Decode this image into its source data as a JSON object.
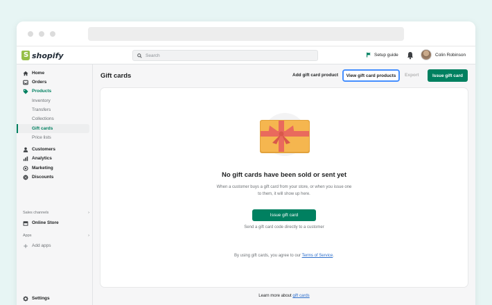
{
  "topbar": {
    "brand": "shopify",
    "search_placeholder": "Search",
    "setup_guide": "Setup guide",
    "user_name": "Colin Robinson"
  },
  "sidebar": {
    "items": [
      {
        "label": "Home",
        "icon": "home-icon"
      },
      {
        "label": "Orders",
        "icon": "orders-icon"
      },
      {
        "label": "Products",
        "icon": "tag-icon"
      }
    ],
    "product_subitems": [
      "Inventory",
      "Transfers",
      "Collections",
      "Gift cards",
      "Price lists"
    ],
    "items2": [
      {
        "label": "Customers",
        "icon": "person-icon"
      },
      {
        "label": "Analytics",
        "icon": "bar-chart-icon"
      },
      {
        "label": "Marketing",
        "icon": "target-icon"
      },
      {
        "label": "Discounts",
        "icon": "discount-icon"
      }
    ],
    "sales_channels": "Sales channels",
    "online_store": "Online Store",
    "apps": "Apps",
    "add_apps": "Add apps",
    "settings": "Settings"
  },
  "header": {
    "title": "Gift cards",
    "add_product": "Add gift card product",
    "view_products": "View gift card products",
    "export": "Export",
    "issue": "Issue gift card"
  },
  "empty_state": {
    "title": "No gift cards have been sold or sent yet",
    "description": "When a customer buys a gift card from your store, or when you issue one to them, it will show up here.",
    "button": "Issue gift card",
    "helper": "Send a gift card code directly to a customer",
    "terms_prefix": "By using gift cards, you agree to our",
    "terms_link": "Terms of Service",
    "terms_suffix": "."
  },
  "footer": {
    "learn_prefix": "Learn more about",
    "learn_link": "gift cards"
  },
  "colors": {
    "accent": "#008060",
    "focus": "#458fff",
    "gift_card": "#f5b64f",
    "ribbon": "#e96a5d"
  }
}
